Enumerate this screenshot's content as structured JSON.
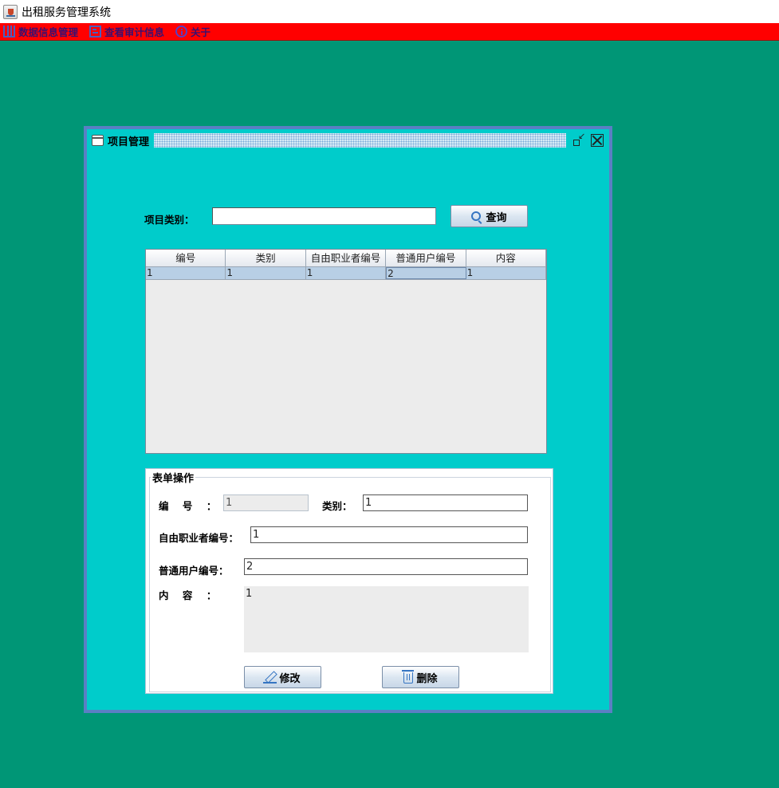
{
  "app": {
    "title": "出租服务管理系统"
  },
  "menu": {
    "items": [
      {
        "label": "数据信息管理",
        "icon": "database-icon"
      },
      {
        "label": "查看审计信息",
        "icon": "audit-icon"
      },
      {
        "label": "关于",
        "icon": "info-icon"
      }
    ]
  },
  "colors": {
    "desktop": "#009676",
    "menubar": "#ff0000",
    "frame_bg": "#00cccb",
    "frame_border": "#5b7fc4",
    "selected_row": "#b8cfe5"
  },
  "frame": {
    "title": "项目管理",
    "search": {
      "label": "项目类别：",
      "value": "",
      "button": "查询"
    },
    "table": {
      "columns": [
        "编号",
        "类别",
        "自由职业者编号",
        "普通用户编号",
        "内容"
      ],
      "rows": [
        [
          "1",
          "1",
          "1",
          "2",
          "1"
        ]
      ]
    },
    "form": {
      "legend": "表单操作",
      "id_label": "编    号    ：",
      "id_value": "1",
      "category_label": "类别：",
      "category_value": "1",
      "freelancer_label": "自由职业者编号：",
      "freelancer_value": "1",
      "user_label": "普通用户编号：",
      "user_value": "2",
      "content_label": "内    容    ：",
      "content_value": "1",
      "edit_button": "修改",
      "delete_button": "删除"
    }
  }
}
